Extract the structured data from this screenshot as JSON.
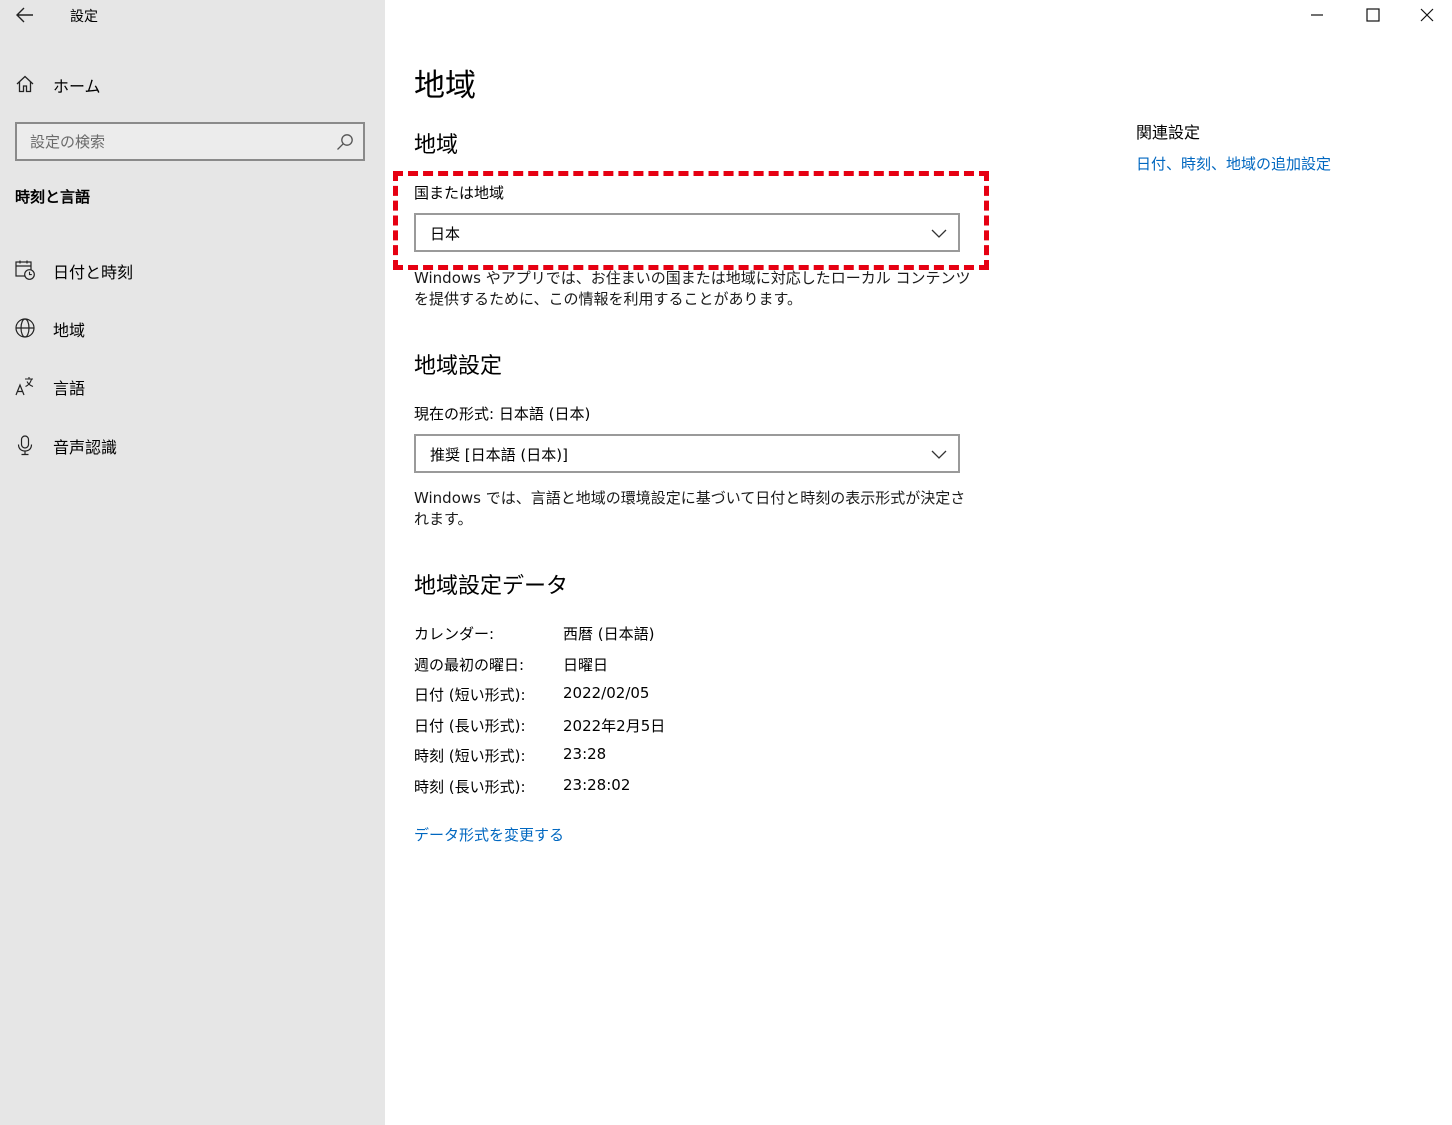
{
  "window": {
    "title": "設定",
    "controls": [
      "minimize-icon",
      "maximize-icon",
      "close-icon"
    ]
  },
  "sidebar": {
    "home_label": "ホーム",
    "search_placeholder": "設定の検索",
    "section_title": "時刻と言語",
    "items": [
      {
        "label": "日付と時刻",
        "icon": "date-time-icon"
      },
      {
        "label": "地域",
        "icon": "globe-icon"
      },
      {
        "label": "言語",
        "icon": "language-icon"
      },
      {
        "label": "音声認識",
        "icon": "microphone-icon"
      }
    ]
  },
  "main": {
    "page_title": "地域",
    "region": {
      "heading": "地域",
      "country_label": "国または地域",
      "country_value": "日本",
      "description": "Windows やアプリでは、お住まいの国または地域に対応したローカル コンテンツを提供するために、この情報を利用することがあります。"
    },
    "format": {
      "heading": "地域設定",
      "current_label": "現在の形式: 日本語 (日本)",
      "dropdown_value": "推奨 [日本語 (日本)]",
      "description": "Windows では、言語と地域の環境設定に基づいて日付と時刻の表示形式が決定されます。"
    },
    "data": {
      "heading": "地域設定データ",
      "rows": [
        {
          "key": "カレンダー:",
          "value": "西暦 (日本語)"
        },
        {
          "key": "週の最初の曜日:",
          "value": "日曜日"
        },
        {
          "key": "日付 (短い形式):",
          "value": "2022/02/05"
        },
        {
          "key": "日付 (長い形式):",
          "value": "2022年2月5日"
        },
        {
          "key": "時刻 (短い形式):",
          "value": "23:28"
        },
        {
          "key": "時刻 (長い形式):",
          "value": "23:28:02"
        }
      ],
      "change_link": "データ形式を変更する"
    }
  },
  "related": {
    "title": "関連設定",
    "link": "日付、時刻、地域の追加設定"
  },
  "colors": {
    "sidebar_bg": "#e6e6e6",
    "link": "#0067c0",
    "highlight": "#e60012"
  }
}
